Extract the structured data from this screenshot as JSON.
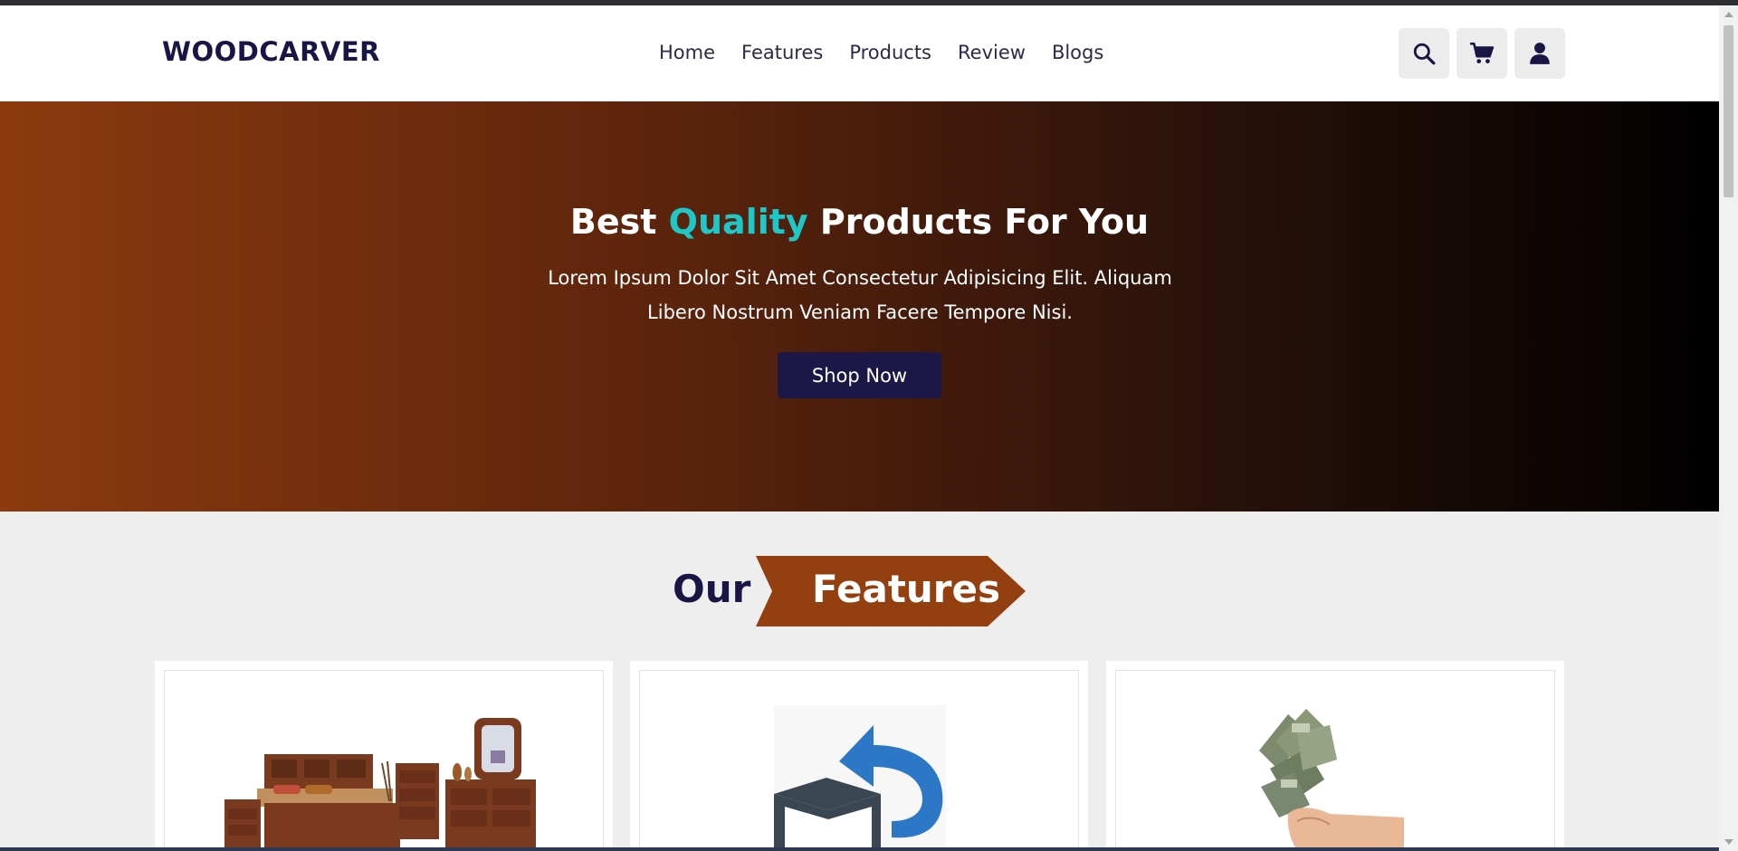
{
  "brand": {
    "logo": "WOODCARVER"
  },
  "nav": {
    "items": [
      "Home",
      "Features",
      "Products",
      "Review",
      "Blogs"
    ]
  },
  "header_icons": [
    "search-icon",
    "cart-icon",
    "user-icon"
  ],
  "hero": {
    "title_before": "Best",
    "title_accent": "Quality",
    "title_after": "Products For You",
    "description": "Lorem Ipsum Dolor Sit Amet Consectetur Adipisicing Elit. Aliquam Libero Nostrum Veniam Facere Tempore Nisi.",
    "button": "Shop Now"
  },
  "features": {
    "title_plain": "Our",
    "title_tag": "Features",
    "cards": [
      {
        "image": "bedroom-furniture-image"
      },
      {
        "image": "return-box-icon"
      },
      {
        "image": "money-hand-image"
      }
    ]
  },
  "colors": {
    "brand": "#191545",
    "accent": "#1fc8c8",
    "wood": "#8c3a0e",
    "button": "#1b1746"
  }
}
